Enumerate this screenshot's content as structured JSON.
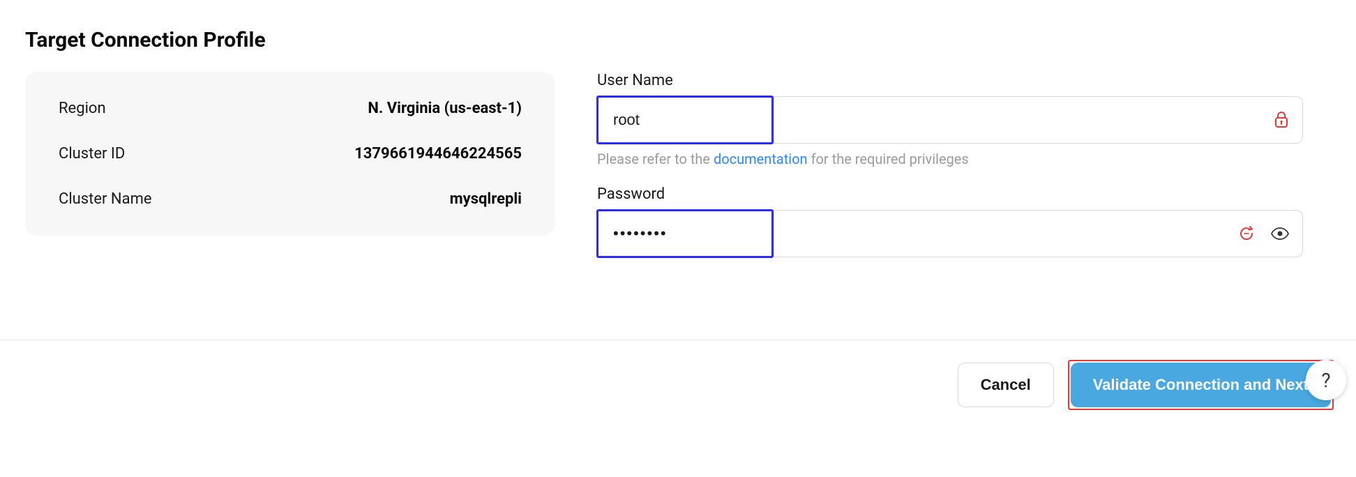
{
  "page": {
    "title": "Target Connection Profile"
  },
  "info_card": {
    "region_label": "Region",
    "region_value": "N. Virginia (us-east-1)",
    "cluster_id_label": "Cluster ID",
    "cluster_id_value": "1379661944646224565",
    "cluster_name_label": "Cluster Name",
    "cluster_name_value": "mysqlrepli"
  },
  "form": {
    "username_label": "User Name",
    "username_value": "root",
    "username_helper_prefix": "Please refer to the ",
    "username_helper_link": "documentation",
    "username_helper_suffix": " for the required privileges",
    "password_label": "Password",
    "password_value": "••••••••"
  },
  "footer": {
    "cancel_label": "Cancel",
    "primary_label": "Validate Connection and Next"
  },
  "help_button": {
    "label": "?"
  }
}
